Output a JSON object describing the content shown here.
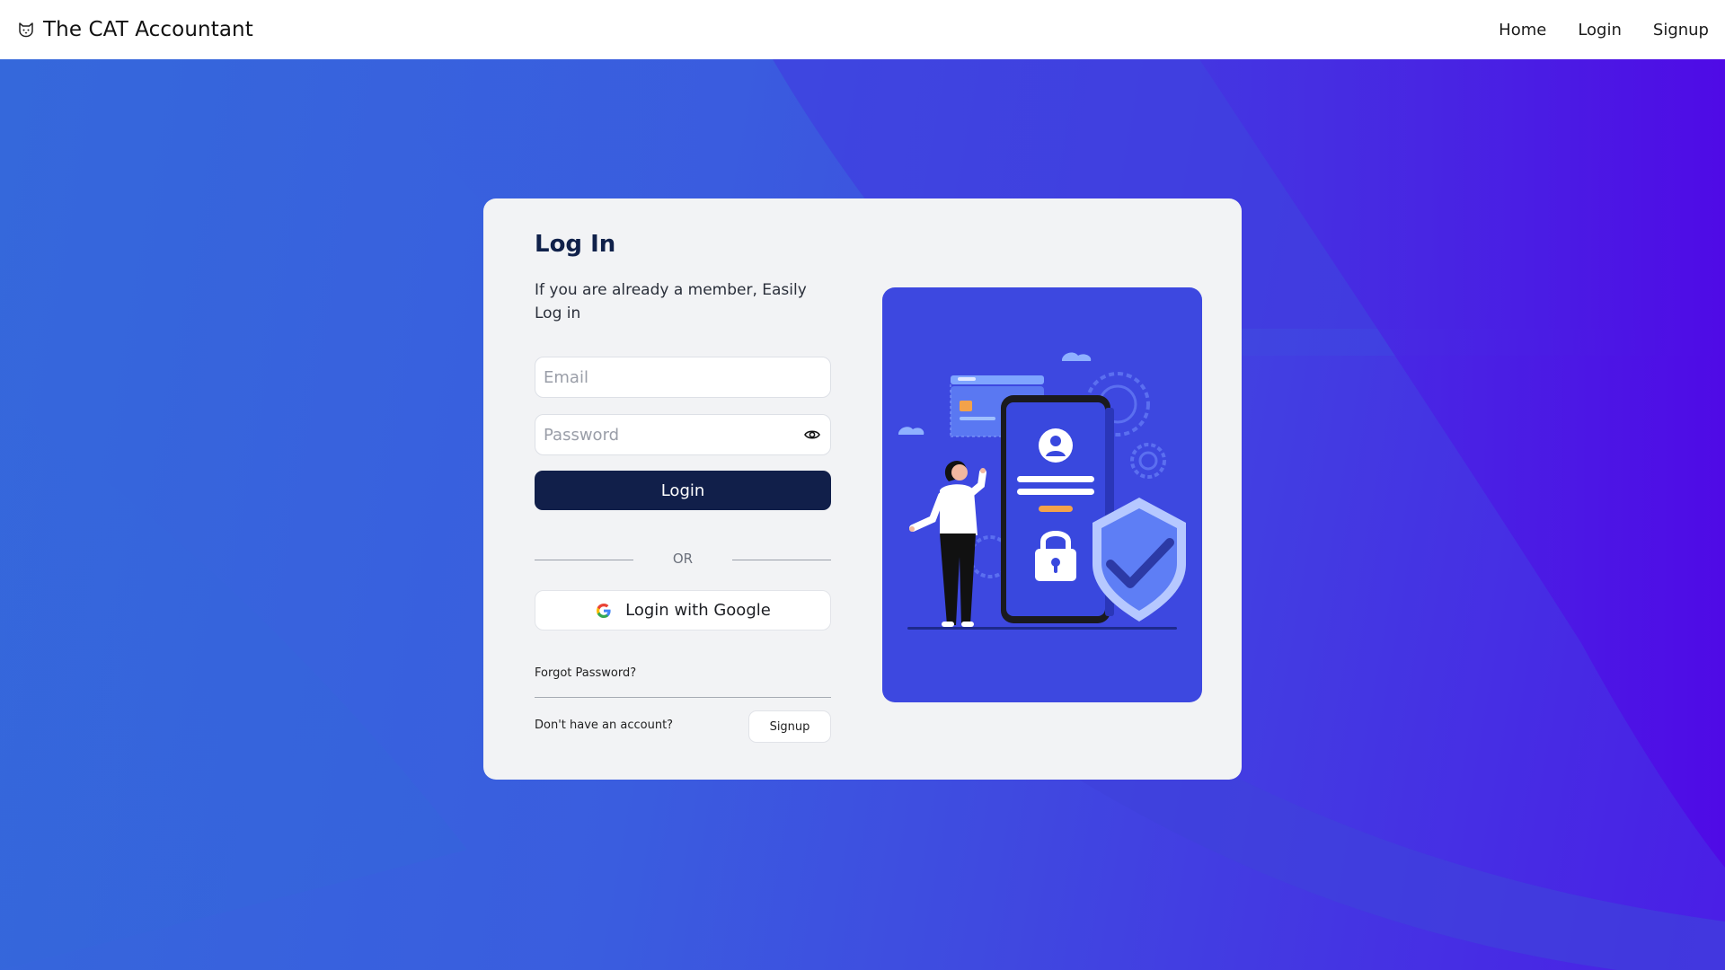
{
  "header": {
    "brand": "The CAT Accountant",
    "nav": {
      "home": "Home",
      "login": "Login",
      "signup": "Signup"
    }
  },
  "login": {
    "title": "Log In",
    "subtitle": "If you are already a member, Easily Log in",
    "email_placeholder": "Email",
    "password_placeholder": "Password",
    "login_button": "Login",
    "or_text": "OR",
    "google_button": "Login with Google",
    "forgot_password": "Forgot Password?",
    "no_account": "Don't have an account?",
    "signup_button": "Signup"
  },
  "icons": {
    "brand": "cat-icon",
    "password_toggle": "eye-icon",
    "google": "google-icon"
  },
  "colors": {
    "header_bg": "#ffffff",
    "card_bg": "#f2f3f5",
    "primary_button": "#111f4a",
    "title": "#10214a",
    "illustration_bg": "#3d48e0",
    "background_start": "#3568db",
    "background_end": "#4a1ee6"
  }
}
